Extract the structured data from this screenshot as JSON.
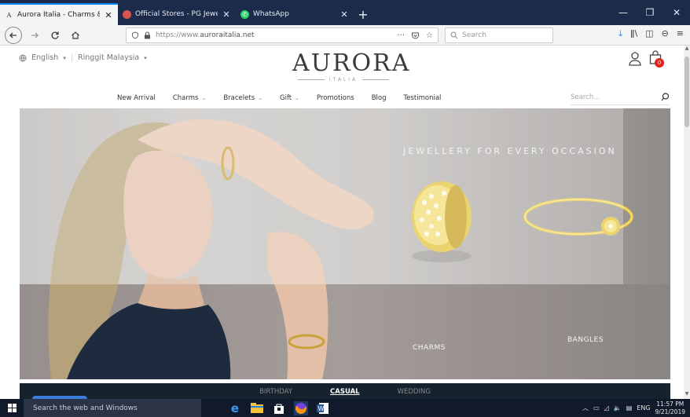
{
  "browser": {
    "tabs": [
      {
        "title": "Aurora Italia - Charms & Brace",
        "active": true,
        "favicon": "A"
      },
      {
        "title": "Official Stores - PG Jewel | New",
        "active": false,
        "favicon": "●"
      },
      {
        "title": "WhatsApp",
        "active": false,
        "favicon": "✆"
      }
    ],
    "new_tab": "+",
    "url_scheme": "https://www.",
    "url_domain": "auroraitalia.net",
    "search_placeholder": "Search",
    "more": "···",
    "window_controls": {
      "min": "—",
      "max": "❐",
      "close": "✕"
    }
  },
  "site": {
    "language": "English",
    "currency": "Ringgit Malaysia",
    "logo_main": "AURORA",
    "logo_sub": "ITALIA",
    "cart_count": "0",
    "menu": [
      {
        "label": "New Arrival",
        "has_dropdown": false
      },
      {
        "label": "Charms",
        "has_dropdown": true
      },
      {
        "label": "Bracelets",
        "has_dropdown": true
      },
      {
        "label": "Gift",
        "has_dropdown": true
      },
      {
        "label": "Promotions",
        "has_dropdown": false
      },
      {
        "label": "Blog",
        "has_dropdown": false
      },
      {
        "label": "Testimonial",
        "has_dropdown": false
      }
    ],
    "search_placeholder": "Search...",
    "hero": {
      "tagline": "JEWELLERY FOR EVERY OCCASION",
      "charms_label": "CHARMS",
      "bangles_label": "BANGLES"
    },
    "occasion_tabs": [
      "BIRTHDAY",
      "CASUAL",
      "WEDDING"
    ],
    "active_occasion": "CASUAL"
  },
  "taskbar": {
    "search_text": "Search the web and Windows",
    "lang": "ENG",
    "time": "11:57 PM",
    "date": "9/21/2019"
  },
  "colors": {
    "accent": "#0a84ff",
    "cart_badge": "#e0241a",
    "tabbar": "#1c2b4a",
    "gold": "#e3c23a"
  }
}
